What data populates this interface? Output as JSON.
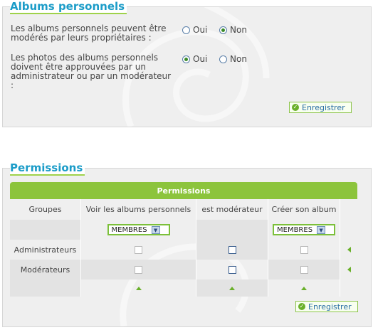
{
  "albums_section": {
    "title": "Albums personnels",
    "q1": {
      "label": "Les albums personnels peuvent être modérés par leurs propriétaires :",
      "yes": "Oui",
      "no": "Non",
      "selected": "no"
    },
    "q2": {
      "label": "Les photos des albums personnels doivent être approuvées par un administrateur ou par un modérateur :",
      "yes": "Oui",
      "no": "Non",
      "selected": "yes"
    },
    "save_label": "Enregistrer"
  },
  "permissions_section": {
    "title": "Permissions",
    "table_title": "Permissions",
    "headers": [
      "Groupes",
      "Voir les albums personnels",
      "est modérateur",
      "Créer son album"
    ],
    "select_value": "MEMBRES",
    "rows": [
      {
        "group": "Administrateurs"
      },
      {
        "group": "Modérateurs"
      }
    ],
    "save_label": "Enregistrer"
  },
  "colors": {
    "accent_blue": "#1b9cc8",
    "accent_green": "#8cc43c"
  }
}
